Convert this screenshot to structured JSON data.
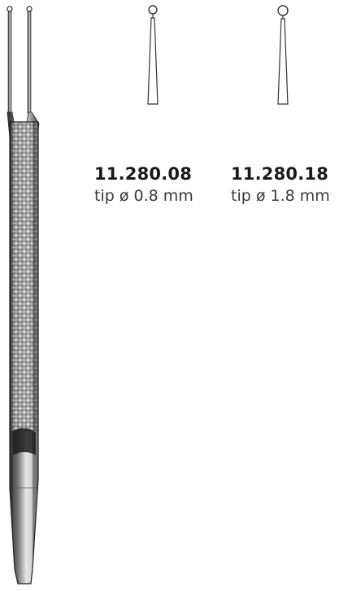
{
  "variants": [
    {
      "code": "11.280.08",
      "tip": "tip ø 0.8 mm"
    },
    {
      "code": "11.280.18",
      "tip": "tip ø 1.8 mm"
    }
  ],
  "colors": {
    "ink": "#1a1a1a",
    "steel_dark": "#2b2b2b",
    "steel_mid": "#6b6b6b",
    "steel_light": "#cfcfcf",
    "background": "#ffffff"
  }
}
